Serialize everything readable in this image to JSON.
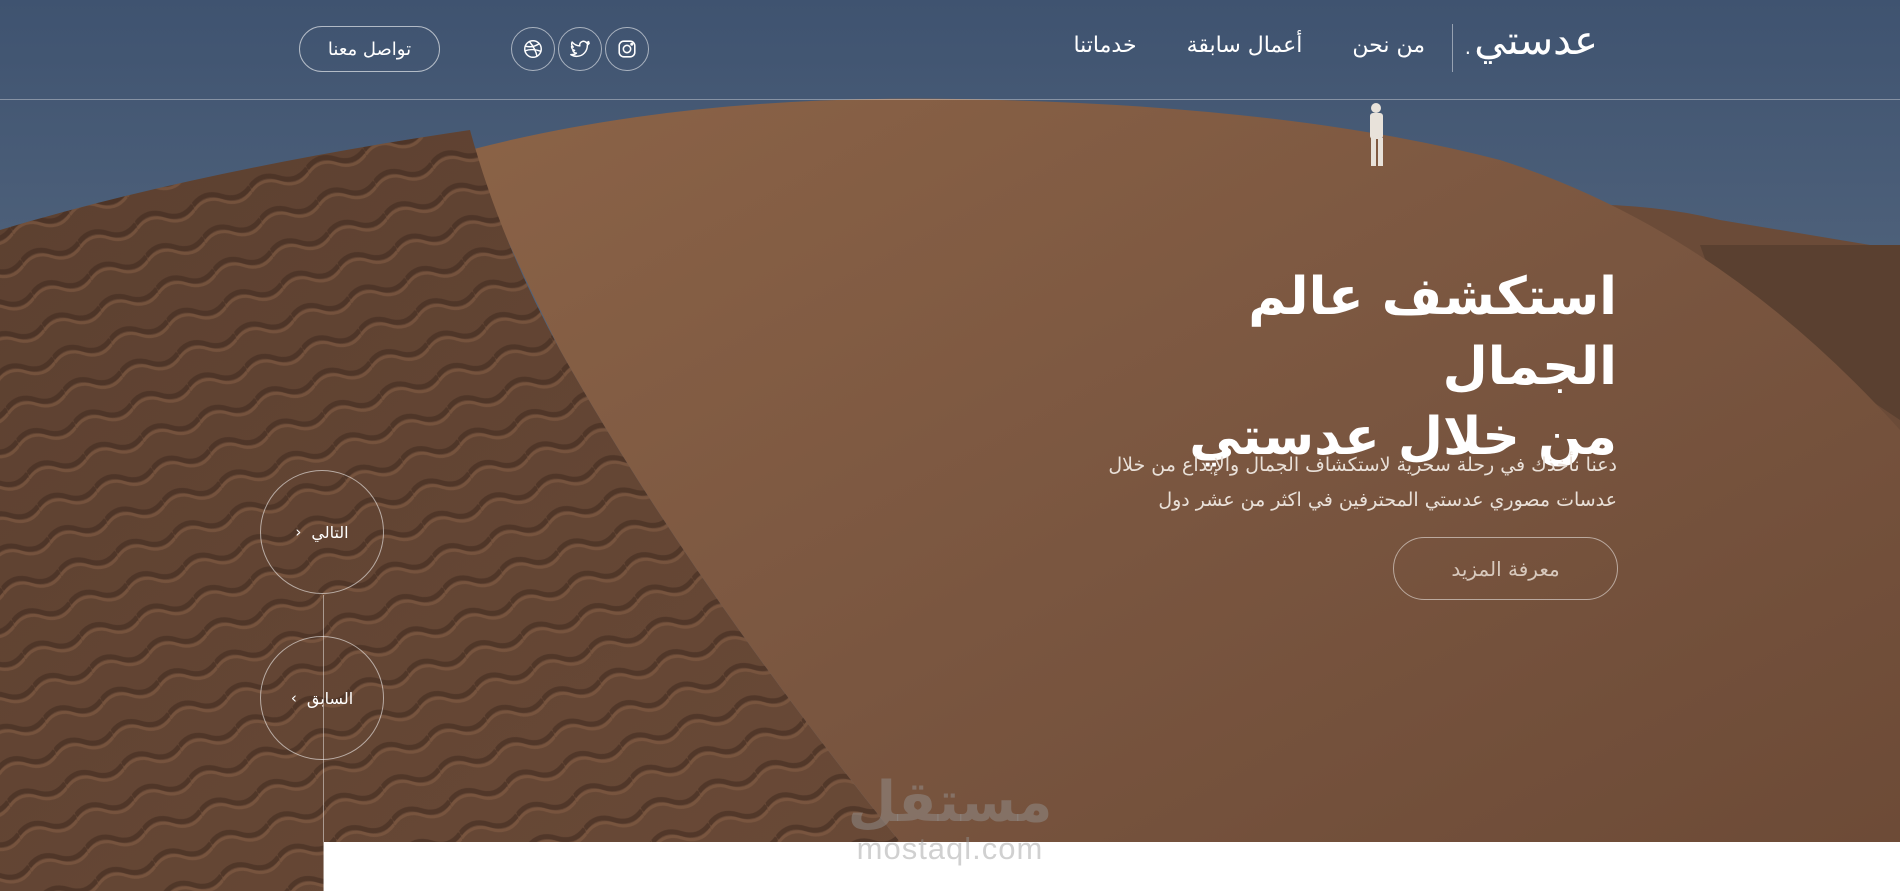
{
  "brand": {
    "logo_text": "عدستي."
  },
  "nav": {
    "items": [
      {
        "label": "خدماتنا"
      },
      {
        "label": "أعمال سابقة"
      },
      {
        "label": "من نحن"
      }
    ]
  },
  "socials": [
    {
      "icon": "instagram-icon"
    },
    {
      "icon": "twitter-icon"
    },
    {
      "icon": "dribbble-icon"
    }
  ],
  "header": {
    "contact_label": "تواصل معنا"
  },
  "hero": {
    "title_line1": "استكشف عالم الجمال",
    "title_line2": "من خلال عدستي",
    "desc_line1": "دعنا نأخذك في رحلة سحرية لاستكشاف الجمال والإبداع من خلال",
    "desc_line2": "عدسات مصوري عدستي المحترفين في اكثر من عشر دول",
    "cta_label": "معرفة المزيد"
  },
  "slider": {
    "next_label": "التالي",
    "prev_label": "السابق"
  },
  "watermark": {
    "arabic": "مستقل",
    "latin": "mostaql.com"
  },
  "colors": {
    "sky": "#4a5d78",
    "sand_light": "#7f5b43",
    "sand_dark": "#5e4130",
    "text": "#ffffff"
  }
}
